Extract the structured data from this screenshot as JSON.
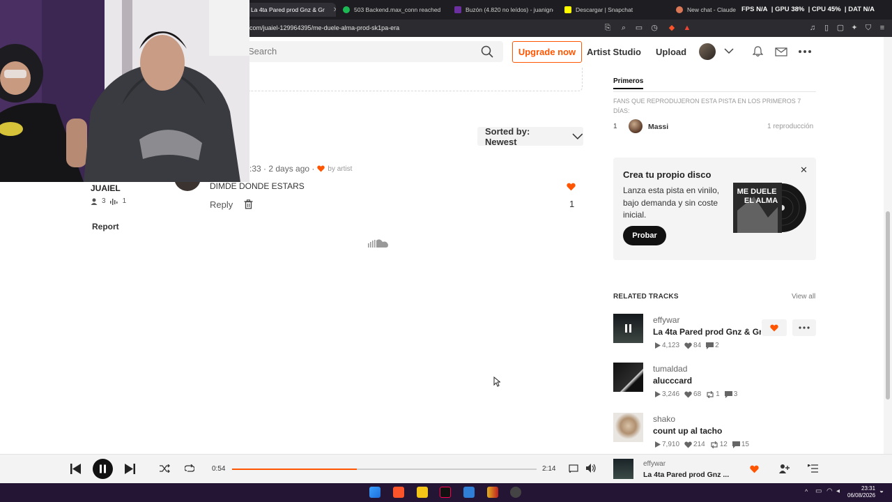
{
  "browser": {
    "tabs": [
      {
        "label": "La 4ta Pared prod Gnz & Gr",
        "active": true
      },
      {
        "label": "503 Backend.max_conn reached"
      },
      {
        "label": "Buzón (4.820 no leídos) - juanigno..."
      },
      {
        "label": "Descargar | Snapchat"
      },
      {
        "label": "New chat - Claude"
      }
    ],
    "stats": {
      "fps_label": "FPS",
      "fps": "N/A",
      "gpu_label": "GPU",
      "gpu": "38%",
      "cpu_label": "CPU",
      "cpu": "45%",
      "dat_label": "DAT",
      "dat": "N/A"
    },
    "url": "com/juaiel-129964395/me-duele-alma-prod-sk1pa-era"
  },
  "header": {
    "search_placeholder": "Search",
    "upgrade": "Upgrade now",
    "artist_studio": "Artist Studio",
    "upload": "Upload"
  },
  "comments": {
    "sort_label": "Sorted by: Newest",
    "meta_time": ":33 · 2 days ago ·",
    "by_artist": "by artist",
    "text": "DIMDE DONDE ESTARS",
    "reply": "Reply",
    "likes": "1"
  },
  "user": {
    "name": "JUAIEL",
    "followers": "3",
    "tracks": "1",
    "report": "Report"
  },
  "fans": {
    "tab": "Primeros",
    "description": "FANS QUE REPRODUJERON ESTA PISTA EN LOS PRIMEROS 7 DÍAS:",
    "rank": "1",
    "name": "Massi",
    "plays": "1 reproducción"
  },
  "vinyl": {
    "title": "Crea tu propio disco",
    "description": "Lanza esta pista en vinilo, bajo demanda y sin coste inicial.",
    "button": "Probar",
    "art_text": "ME DUELE EL ALMA"
  },
  "related": {
    "header": "RELATED TRACKS",
    "view_all": "View all",
    "tracks": [
      {
        "artist": "effywar",
        "title": "La 4ta Pared prod Gnz & Gr",
        "plays": "4,123",
        "likes": "84",
        "reposts": "",
        "comments": "2"
      },
      {
        "artist": "tumaldad",
        "title": "alucccard",
        "plays": "3,246",
        "likes": "68",
        "reposts": "1",
        "comments": "3"
      },
      {
        "artist": "shako",
        "title": "count up al tacho",
        "plays": "7,910",
        "likes": "214",
        "reposts": "12",
        "comments": "15"
      }
    ]
  },
  "player": {
    "current": "0:54",
    "total": "2:14",
    "progress": 0.41,
    "artist": "effywar",
    "title": "La 4ta Pared prod Gnz ..."
  },
  "taskbar": {
    "time": "23:31",
    "date": "06/08/2026"
  },
  "colors": {
    "accent": "#ff5500"
  }
}
